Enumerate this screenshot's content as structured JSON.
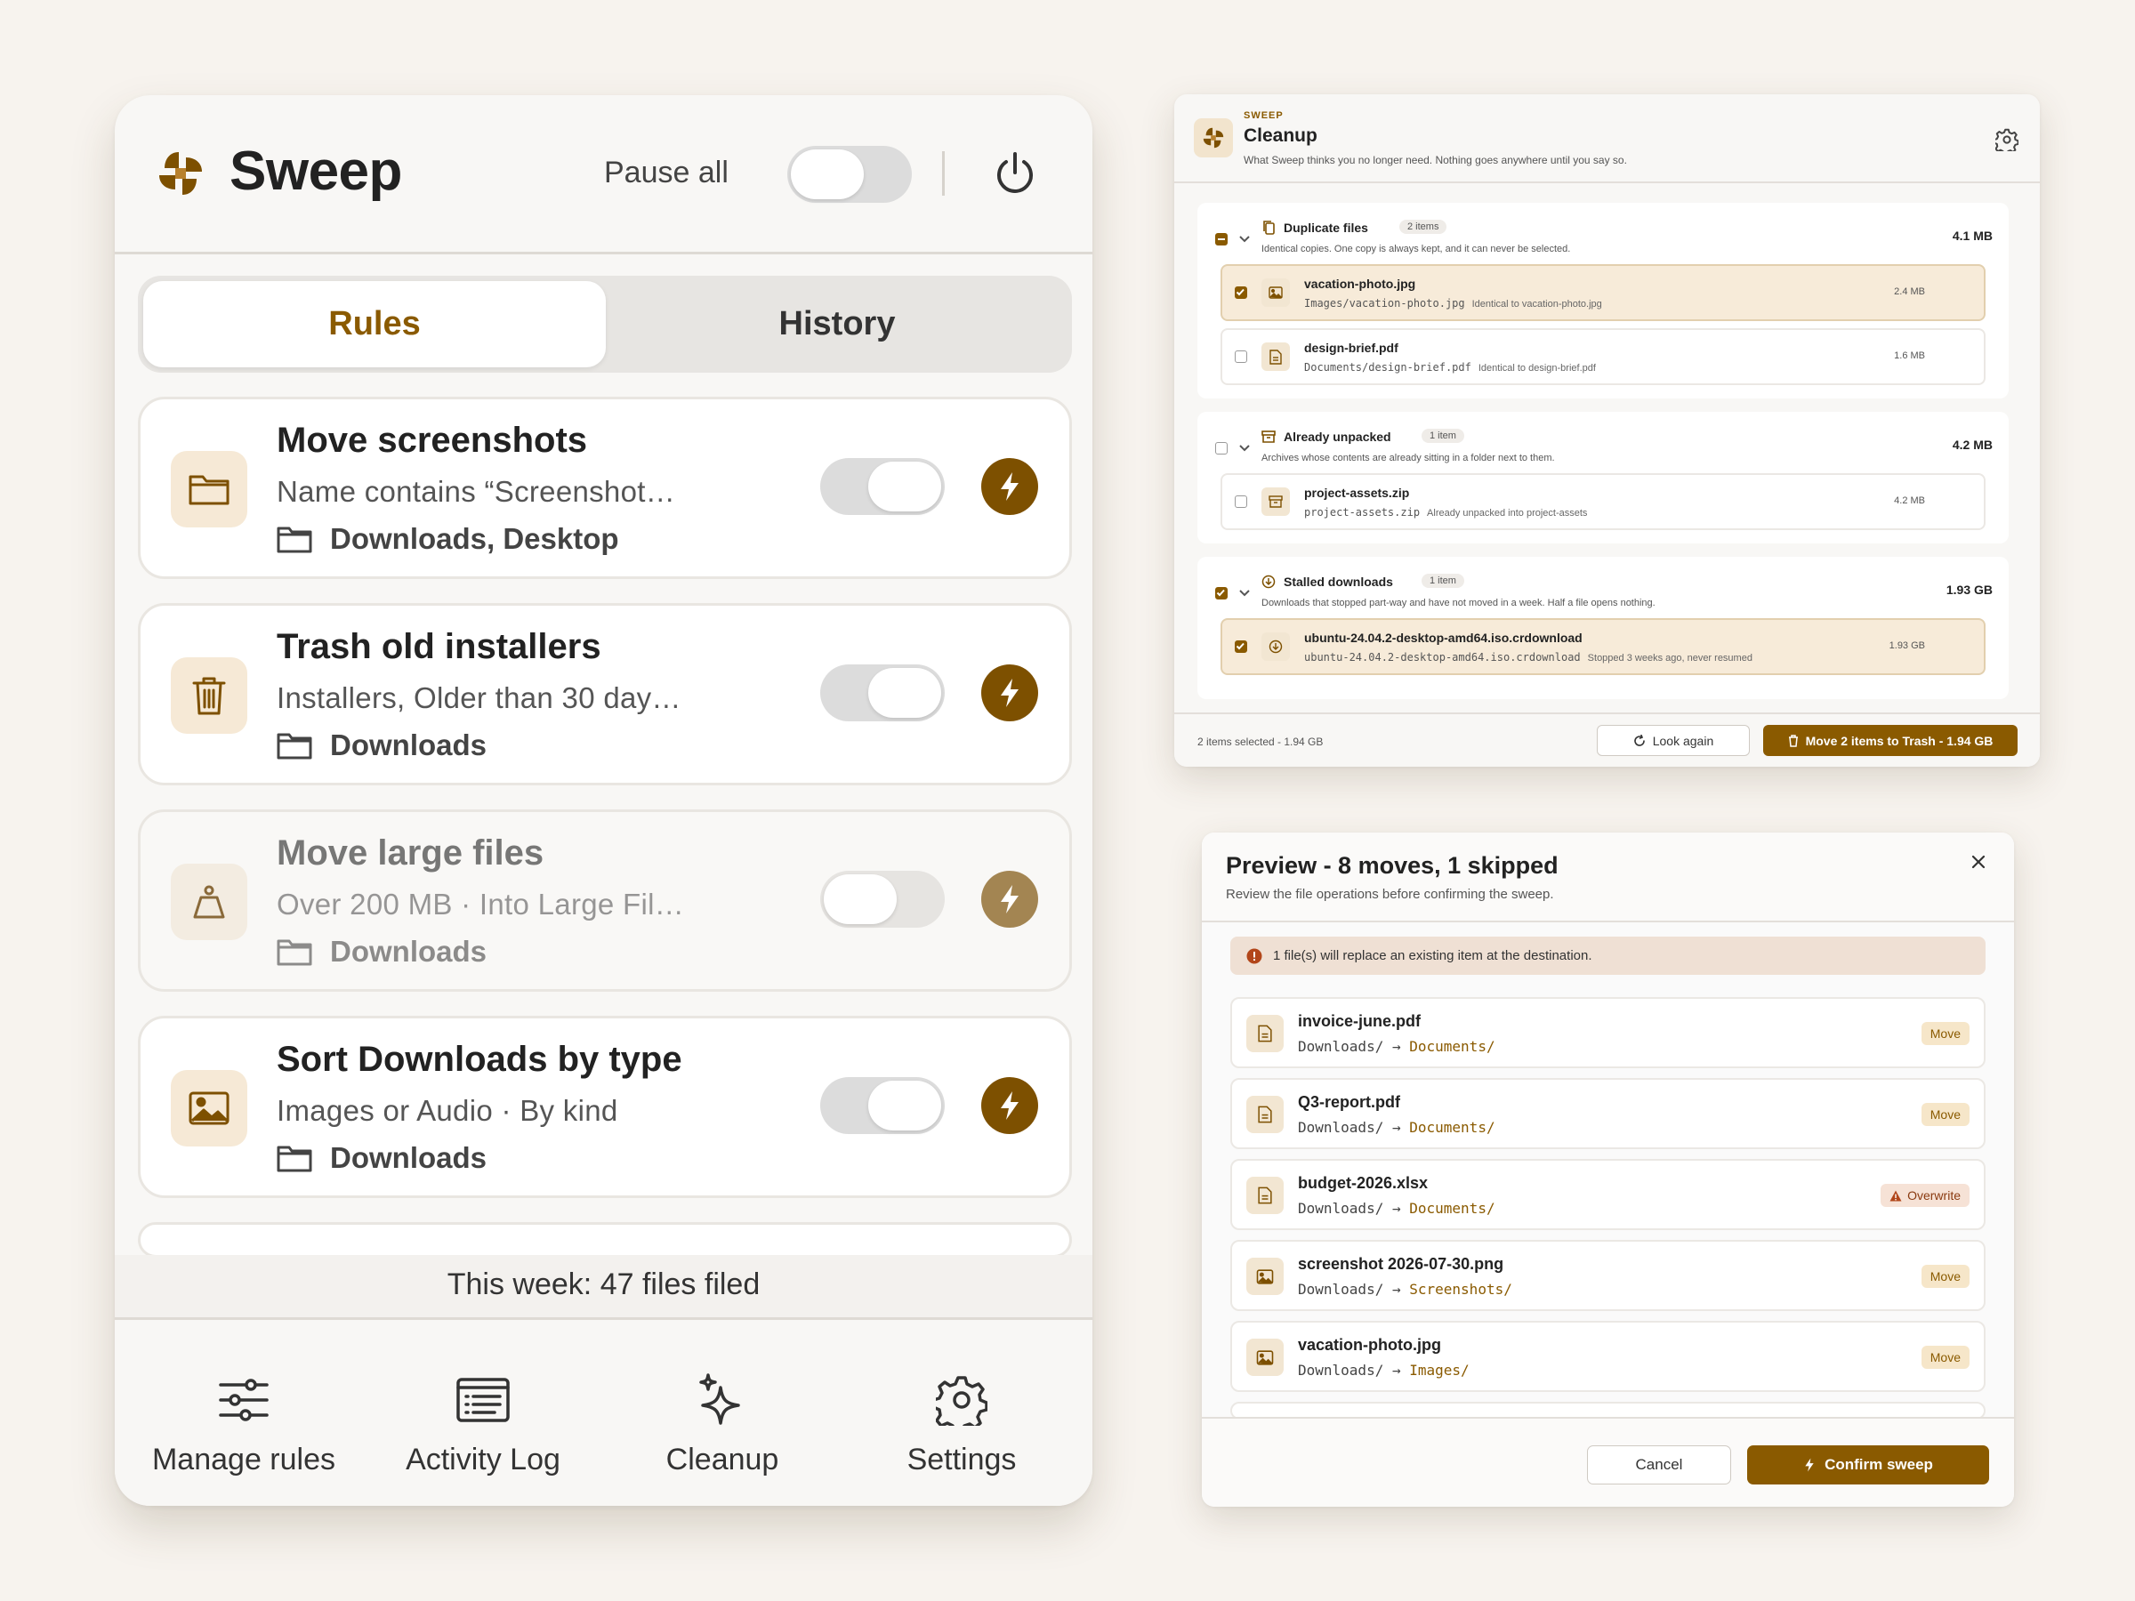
{
  "colors": {
    "accent": "#8a5a00",
    "accent_light": "#f6e9d6",
    "background": "#f7f3ee",
    "warning": "#b2461a"
  },
  "left": {
    "app_name": "Sweep",
    "pause_all_label": "Pause all",
    "pause_all_on": false,
    "tabs": [
      {
        "label": "Rules",
        "active": true
      },
      {
        "label": "History",
        "active": false
      }
    ],
    "rules": [
      {
        "name": "Move screenshots",
        "desc": "Name contains “Screenshot…",
        "folders": "Downloads, Desktop",
        "icon": "folder-icon",
        "enabled": true
      },
      {
        "name": "Trash old installers",
        "desc": "Installers, Older than 30 day…",
        "folders": "Downloads",
        "icon": "trash-icon",
        "enabled": true
      },
      {
        "name": "Move large files",
        "desc": "Over 200 MB · Into Large Fil…",
        "folders": "Downloads",
        "icon": "weight-icon",
        "enabled": false
      },
      {
        "name": "Sort Downloads by type",
        "desc": "Images or Audio · By kind",
        "folders": "Downloads",
        "icon": "image-icon",
        "enabled": true
      }
    ],
    "week_stat": "This week: 47 files filed",
    "footer": [
      {
        "label": "Manage rules",
        "icon": "sliders-icon"
      },
      {
        "label": "Activity Log",
        "icon": "log-icon"
      },
      {
        "label": "Cleanup",
        "icon": "sparkle-icon"
      },
      {
        "label": "Settings",
        "icon": "gear-icon"
      }
    ]
  },
  "cleanup": {
    "eyebrow": "SWEEP",
    "title": "Cleanup",
    "subtitle": "What Sweep thinks you no longer need. Nothing goes anywhere until you say so.",
    "groups": [
      {
        "title": "Duplicate files",
        "count": "2 items",
        "desc": "Identical copies. One copy is always kept, and it can never be selected.",
        "size": "4.1 MB",
        "items": [
          {
            "name": "vacation-photo.jpg",
            "path": "Images/vacation-photo.jpg",
            "note": "Identical to vacation-photo.jpg",
            "size": "2.4 MB",
            "selected": true
          },
          {
            "name": "design-brief.pdf",
            "path": "Documents/design-brief.pdf",
            "note": "Identical to design-brief.pdf",
            "size": "1.6 MB",
            "selected": false
          }
        ]
      },
      {
        "title": "Already unpacked",
        "count": "1 item",
        "desc": "Archives whose contents are already sitting in a folder next to them.",
        "size": "4.2 MB",
        "items": [
          {
            "name": "project-assets.zip",
            "path": "project-assets.zip",
            "note": "Already unpacked into project-assets",
            "size": "4.2 MB",
            "selected": false
          }
        ]
      },
      {
        "title": "Stalled downloads",
        "count": "1 item",
        "desc": "Downloads that stopped part-way and have not moved in a week. Half a file opens nothing.",
        "size": "1.93 GB",
        "items": [
          {
            "name": "ubuntu-24.04.2-desktop-amd64.iso.crdownload",
            "path": "ubuntu-24.04.2-desktop-amd64.iso.crdownload",
            "note": "Stopped 3 weeks ago, never resumed",
            "size": "1.93 GB",
            "selected": true
          }
        ]
      }
    ],
    "selection_summary": "2 items selected - 1.94 GB",
    "look_again_label": "Look again",
    "move_label": "Move 2 items to Trash - 1.94 GB"
  },
  "preview": {
    "title": "Preview - 8 moves, 1 skipped",
    "subtitle": "Review the file operations before confirming the sweep.",
    "warning": "1 file(s) will replace an existing item at the destination.",
    "ops": [
      {
        "name": "invoice-june.pdf",
        "src": "Downloads/",
        "dst": "Documents/",
        "badge": "Move",
        "icon": "document-icon"
      },
      {
        "name": "Q3-report.pdf",
        "src": "Downloads/",
        "dst": "Documents/",
        "badge": "Move",
        "icon": "document-icon"
      },
      {
        "name": "budget-2026.xlsx",
        "src": "Downloads/",
        "dst": "Documents/",
        "badge": "Overwrite",
        "icon": "document-icon"
      },
      {
        "name": "screenshot 2026-07-30.png",
        "src": "Downloads/",
        "dst": "Screenshots/",
        "badge": "Move",
        "icon": "image-icon"
      },
      {
        "name": "vacation-photo.jpg",
        "src": "Downloads/",
        "dst": "Images/",
        "badge": "Move",
        "icon": "image-icon"
      }
    ],
    "arrow": "→",
    "cancel_label": "Cancel",
    "confirm_label": "Confirm sweep"
  }
}
